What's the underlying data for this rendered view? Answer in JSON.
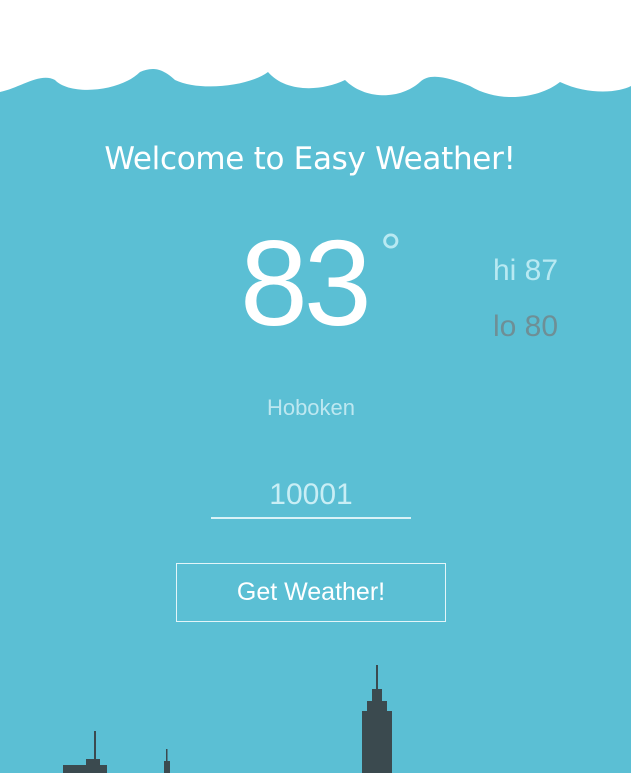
{
  "header": {
    "title": "Welcome to Easy Weather!"
  },
  "weather": {
    "temperature": "83",
    "degree_symbol": "°",
    "high": "hi 87",
    "low": "lo 80",
    "city": "Hoboken"
  },
  "search": {
    "zip_value": "10001"
  },
  "actions": {
    "get_weather_label": "Get Weather!"
  },
  "colors": {
    "background": "#5bbfd4",
    "clouds": "#ffffff",
    "skyline": "#3b4a4f",
    "high_text": "#b8e9f2",
    "low_text": "#6e8f96"
  }
}
